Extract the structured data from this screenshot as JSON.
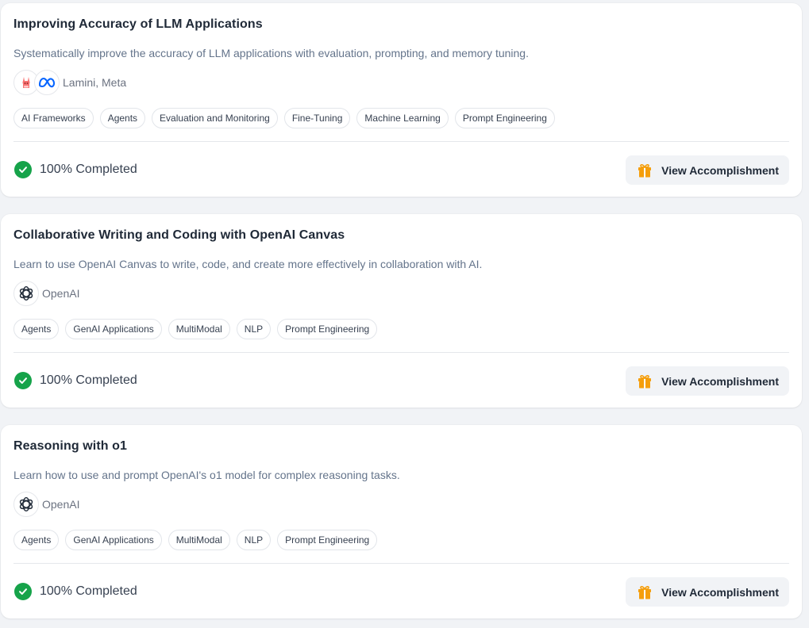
{
  "colors": {
    "page_bg": "#f1f3f6",
    "card_bg": "#ffffff",
    "title": "#1f2937",
    "description": "#64748b",
    "complete_green": "#16a34a",
    "gift_orange": "#f59e0b",
    "meta_blue": "#0866ff",
    "lamini_red": "#e5484d"
  },
  "courses": [
    {
      "title": "Improving Accuracy of LLM Applications",
      "description": "Systematically improve the accuracy of LLM applications with evaluation, prompting, and memory tuning.",
      "partner_icons": [
        "lamini-llama-icon",
        "meta-logo-icon"
      ],
      "partners": "Lamini, Meta",
      "tags": [
        "AI Frameworks",
        "Agents",
        "Evaluation and Monitoring",
        "Fine-Tuning",
        "Machine Learning",
        "Prompt Engineering"
      ],
      "status": "100% Completed",
      "progress_percent": 100,
      "action_label": "View Accomplishment"
    },
    {
      "title": "Collaborative Writing and Coding with OpenAI Canvas",
      "description": "Learn to use OpenAI Canvas to write, code, and create more effectively in collaboration with AI.",
      "partner_icons": [
        "openai-logo-icon"
      ],
      "partners": "OpenAI",
      "tags": [
        "Agents",
        "GenAI Applications",
        "MultiModal",
        "NLP",
        "Prompt Engineering"
      ],
      "status": "100% Completed",
      "progress_percent": 100,
      "action_label": "View Accomplishment"
    },
    {
      "title": "Reasoning with o1",
      "description": "Learn how to use and prompt OpenAI's o1 model for complex reasoning tasks.",
      "partner_icons": [
        "openai-logo-icon"
      ],
      "partners": "OpenAI",
      "tags": [
        "Agents",
        "GenAI Applications",
        "MultiModal",
        "NLP",
        "Prompt Engineering"
      ],
      "status": "100% Completed",
      "progress_percent": 100,
      "action_label": "View Accomplishment"
    }
  ]
}
